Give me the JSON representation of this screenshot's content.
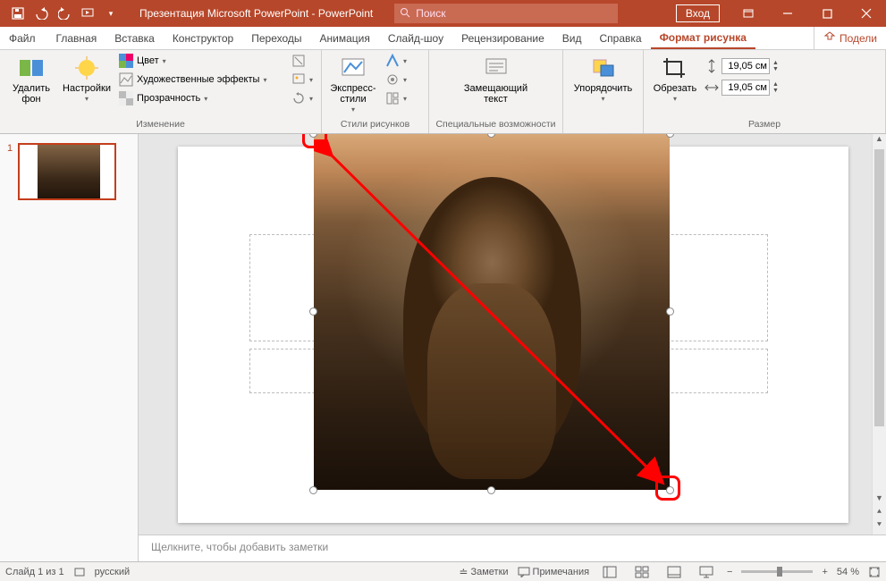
{
  "titlebar": {
    "doc_title": "Презентация Microsoft PowerPoint  -  PowerPoint",
    "search_placeholder": "Поиск",
    "login": "Вход"
  },
  "tabs": {
    "file": "Файл",
    "home": "Главная",
    "insert": "Вставка",
    "design": "Конструктор",
    "transitions": "Переходы",
    "animation": "Анимация",
    "slideshow": "Слайд-шоу",
    "review": "Рецензирование",
    "view": "Вид",
    "help": "Справка",
    "picture_format": "Формат рисунка",
    "share": "Подели"
  },
  "ribbon": {
    "remove_bg": "Удалить фон",
    "corrections": "Настройки",
    "color": "Цвет",
    "artistic": "Художественные эффекты",
    "transparency": "Прозрачность",
    "group_adjust": "Изменение",
    "styles": "Экспресс-стили",
    "group_styles": "Стили рисунков",
    "alt_text": "Замещающий текст",
    "group_access": "Специальные возможности",
    "arrange": "Упорядочить",
    "crop": "Обрезать",
    "height": "19,05 см",
    "width": "19,05 см",
    "group_size": "Размер"
  },
  "thumbs": {
    "n1": "1"
  },
  "notes_placeholder": "Щелкните, чтобы добавить заметки",
  "statusbar": {
    "slide_of": "Слайд 1 из 1",
    "lang": "русский",
    "notes": "Заметки",
    "comments": "Примечания",
    "zoom": "54 %"
  }
}
